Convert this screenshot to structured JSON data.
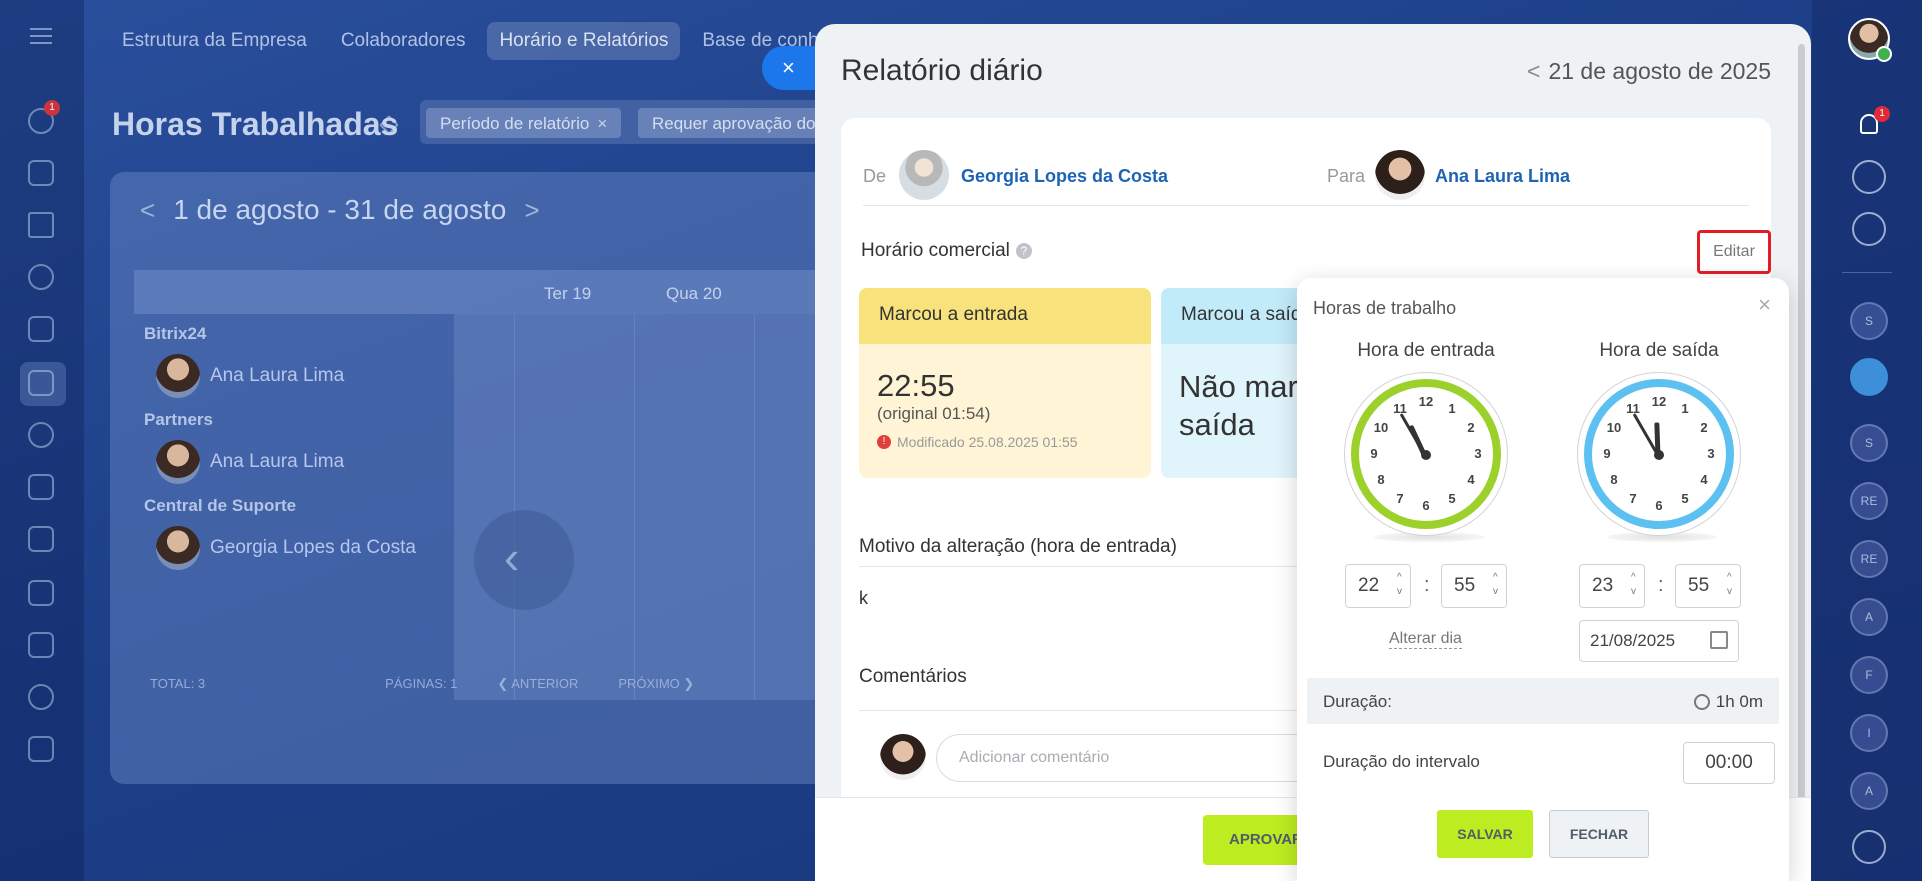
{
  "background": {
    "nav_tabs": [
      "Estrutura da Empresa",
      "Colaboradores",
      "Horário e Relatórios",
      "Base de conhe"
    ],
    "page_title": "Horas Trabalhadas",
    "filter_chips": [
      "Período de relatório",
      "Requer aprovação do"
    ],
    "chip_close": "×",
    "period": "1 de agosto - 31 de agosto",
    "prev_arrow": "<",
    "next_arrow": ">",
    "day_headers": [
      "Ter 19",
      "Qua 20"
    ],
    "groups": [
      {
        "name": "Bitrix24",
        "person": "Ana Laura Lima"
      },
      {
        "name": "Partners",
        "person": "Ana Laura Lima"
      },
      {
        "name": "Central de Suporte",
        "person": "Georgia Lopes da Costa"
      }
    ],
    "nav_back": "‹",
    "totals": {
      "total": "TOTAL: 3",
      "pages": "PÁGINAS: 1",
      "prev": "❮ ANTERIOR",
      "next": "PRÓXIMO ❯"
    },
    "left_badge": "1",
    "right_badge": "1",
    "right_avatars": [
      "S",
      "S",
      "RE",
      "RE",
      "A",
      "F",
      "I",
      "A"
    ]
  },
  "panel": {
    "close_label": "×",
    "title": "Relatório diário",
    "date_prev": "<",
    "date": "21 de agosto de 2025",
    "from_label": "De",
    "from_name": "Georgia Lopes da Costa",
    "to_label": "Para",
    "to_name": "Ana Laura Lima",
    "business_hours_label": "Horário comercial",
    "help_glyph": "?",
    "edit_label": "Editar",
    "checkin": {
      "header": "Marcou a entrada",
      "time": "22:55",
      "original": "(original 01:54)",
      "modified_icon": "!",
      "modified": "Modificado 25.08.2025 01:55"
    },
    "checkout": {
      "header": "Marcou a saída",
      "value_line1": "Não marcou a",
      "value_line2": "saída"
    },
    "reason_label": "Motivo da alteração (hora de entrada)",
    "reason_value": "k",
    "comments_label": "Comentários",
    "comment_placeholder": "Adicionar comentário",
    "approve_label": "APROVAR"
  },
  "popup": {
    "title": "Horas de trabalho",
    "close": "×",
    "start_label": "Hora de entrada",
    "end_label": "Hora de saída",
    "clock_numbers": [
      "12",
      "1",
      "2",
      "3",
      "4",
      "5",
      "6",
      "7",
      "8",
      "9",
      "10",
      "11"
    ],
    "start_hour": "22",
    "start_min": "55",
    "end_hour": "23",
    "end_min": "55",
    "colon": ":",
    "spin_up": "^",
    "spin_down": "v",
    "change_day": "Alterar dia",
    "end_date": "21/08/2025",
    "duration_label": "Duração:",
    "duration_value": "1h 0m",
    "break_label": "Duração do intervalo",
    "break_value": "00:00",
    "save_label": "SALVAR",
    "close_label": "FECHAR"
  },
  "colors": {
    "accent_blue": "#1b77ea",
    "save_green": "#bbed21",
    "checkin_yellow": "#f8e27c",
    "checkout_blue": "#c1ebf9",
    "clock_green": "#9cd02a",
    "clock_blue": "#5cc1f0",
    "highlight_red": "#e11e26"
  }
}
